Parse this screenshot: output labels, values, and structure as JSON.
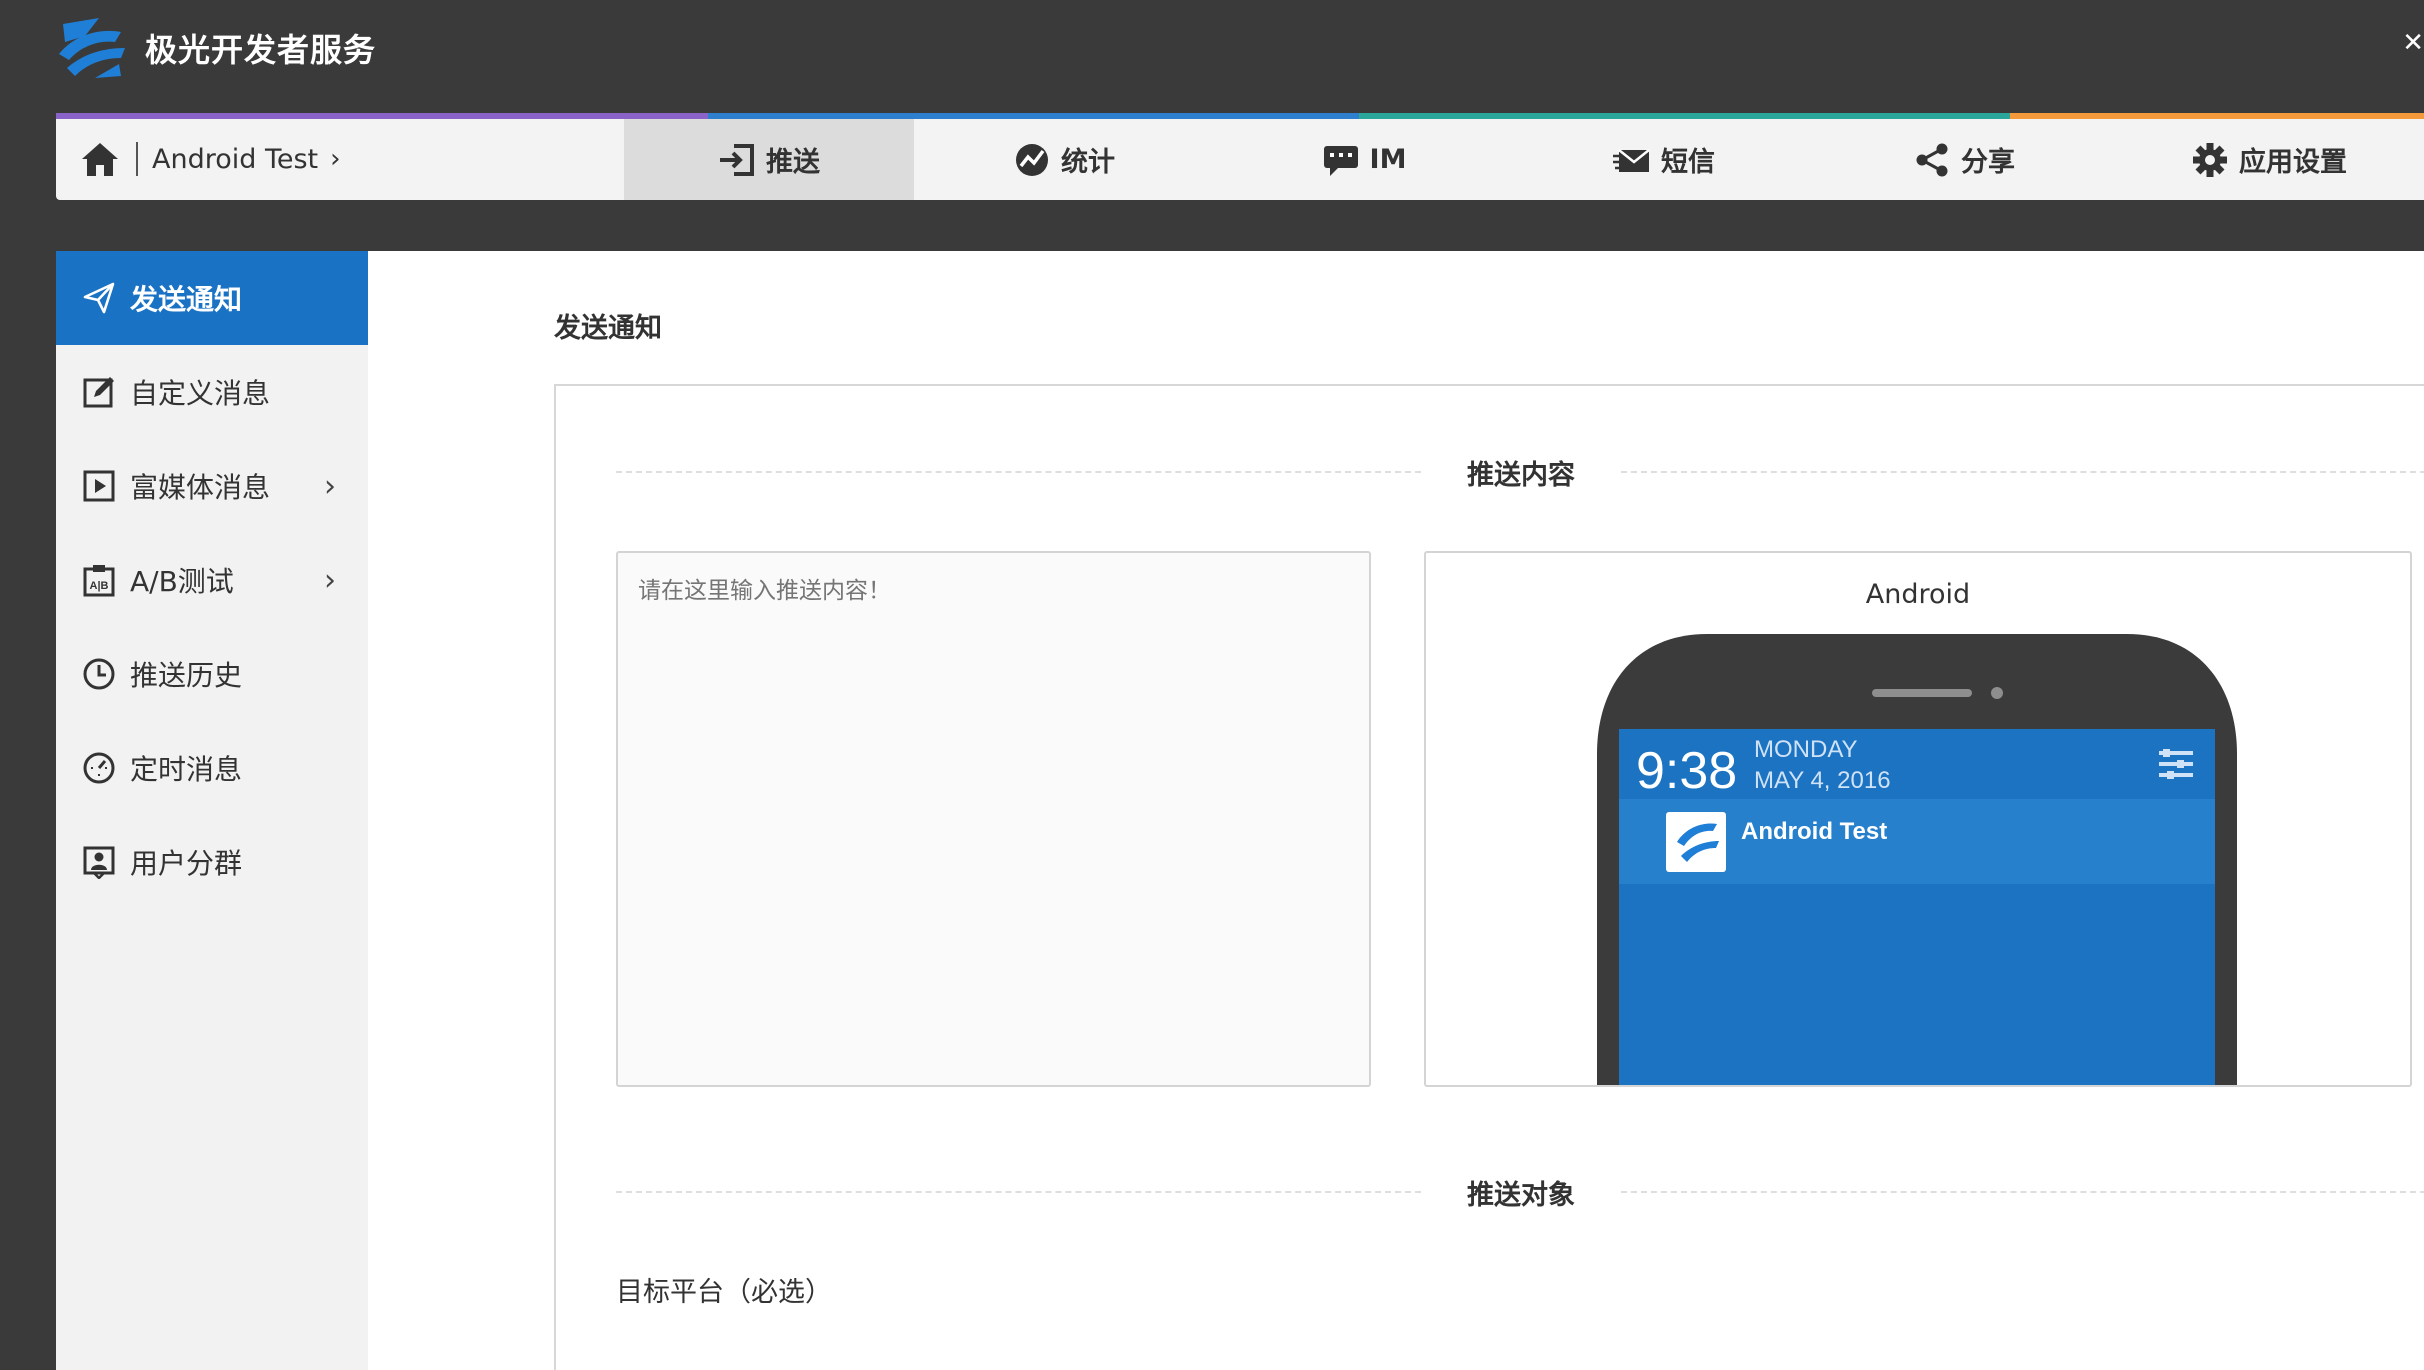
{
  "header": {
    "brand": "极光开发者服务"
  },
  "breadcrumb": {
    "app_name": "Android Test",
    "chevron": "›"
  },
  "nav_tabs": [
    {
      "label": "推送",
      "icon": "push-icon",
      "active": true
    },
    {
      "label": "统计",
      "icon": "stats-icon",
      "active": false
    },
    {
      "label": "IM",
      "icon": "chat-icon",
      "active": false
    },
    {
      "label": "短信",
      "icon": "sms-icon",
      "active": false
    },
    {
      "label": "分享",
      "icon": "share-icon",
      "active": false
    },
    {
      "label": "应用设置",
      "icon": "gear-icon",
      "active": false
    }
  ],
  "sidebar": {
    "items": [
      {
        "label": "发送通知",
        "icon": "send-icon",
        "active": true
      },
      {
        "label": "自定义消息",
        "icon": "edit-icon"
      },
      {
        "label": "富媒体消息",
        "icon": "media-icon",
        "has_submenu": true
      },
      {
        "label": "A/B测试",
        "icon": "ab-test-icon",
        "has_submenu": true
      },
      {
        "label": "推送历史",
        "icon": "history-clock-icon"
      },
      {
        "label": "定时消息",
        "icon": "timer-icon"
      },
      {
        "label": "用户分群",
        "icon": "user-group-icon"
      }
    ],
    "submenu_chevron": "›"
  },
  "main": {
    "title": "发送通知",
    "section_content": "推送内容",
    "content_placeholder": "请在这里输入推送内容！",
    "preview": {
      "platform_label": "Android",
      "time": "9:38",
      "day": "MONDAY",
      "date": "MAY 4, 2016",
      "notification_app": "Android Test"
    },
    "section_target": "推送对象",
    "target_platform_label": "目标平台（必选）"
  },
  "colors": {
    "primary": "#1a72c5",
    "header_bg": "#3a3a3a",
    "stripe": [
      "#8a63c9",
      "#2f7fcf",
      "#2aa79a",
      "#f59a3a"
    ]
  }
}
